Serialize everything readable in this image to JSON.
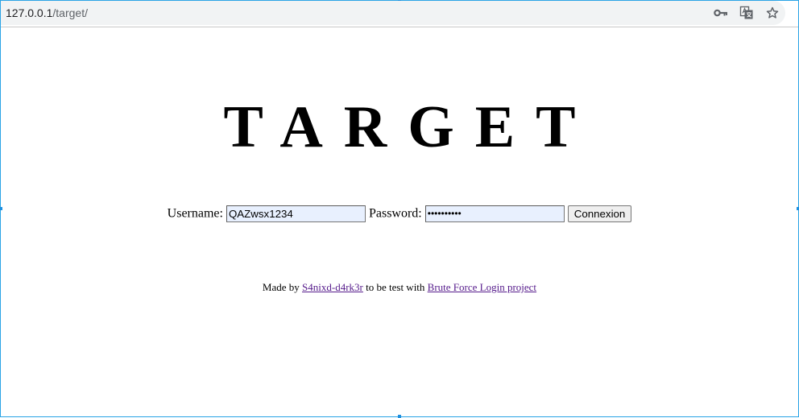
{
  "browser": {
    "url_host": "127.0.0.1",
    "url_path": "/target/",
    "icons": [
      "key-icon",
      "translate-icon",
      "star-icon"
    ]
  },
  "page": {
    "title": "TARGET",
    "username_label": "Username:",
    "username_value": "QAZwsx1234",
    "password_label": "Password:",
    "password_masked": "••••••••••",
    "submit_label": "Connexion"
  },
  "footer": {
    "made_by": "Made by",
    "author_link": "S4nixd-d4rk3r",
    "middle_text": "to be test with",
    "project_link": "Brute Force Login project"
  },
  "colors": {
    "autofill_bg": "#e8f0fe",
    "visited_link": "#551a8b",
    "selection_border": "#2aa4e6"
  }
}
